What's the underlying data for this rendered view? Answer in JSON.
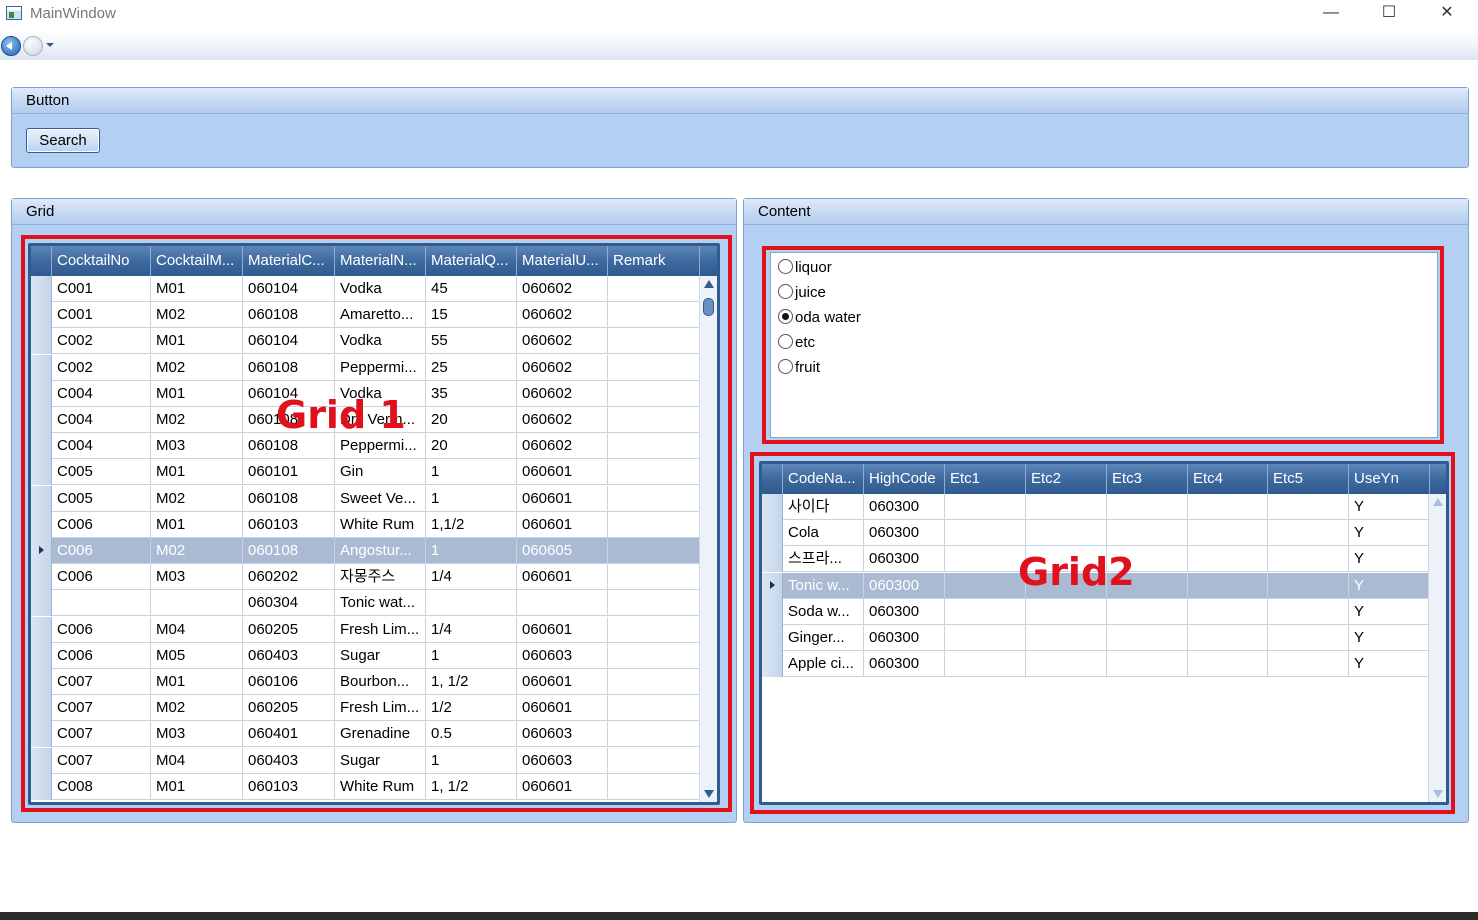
{
  "window": {
    "title": "MainWindow",
    "minimize": "—",
    "maximize": "☐",
    "close": "✕"
  },
  "button_group": {
    "header": "Button",
    "search_label": "Search"
  },
  "grid_group": {
    "header": "Grid"
  },
  "content_group": {
    "header": "Content"
  },
  "grid1": {
    "columns": [
      "CocktailNo",
      "CocktailM...",
      "MaterialC...",
      "MaterialN...",
      "MaterialQ...",
      "MaterialU...",
      "Remark"
    ],
    "rows": [
      [
        "C001",
        "M01",
        "060104",
        "Vodka",
        "45",
        "060602",
        ""
      ],
      [
        "C001",
        "M02",
        "060108",
        "Amaretto...",
        "15",
        "060602",
        ""
      ],
      [
        "C002",
        "M01",
        "060104",
        "Vodka",
        "55",
        "060602",
        ""
      ],
      [
        "C002",
        "M02",
        "060108",
        "Peppermi...",
        "25",
        "060602",
        ""
      ],
      [
        "C004",
        "M01",
        "060104",
        "Vodka",
        "35",
        "060602",
        ""
      ],
      [
        "C004",
        "M02",
        "060108",
        "Dry Verm...",
        "20",
        "060602",
        ""
      ],
      [
        "C004",
        "M03",
        "060108",
        "Peppermi...",
        "20",
        "060602",
        ""
      ],
      [
        "C005",
        "M01",
        "060101",
        "Gin",
        "1",
        "060601",
        ""
      ],
      [
        "C005",
        "M02",
        "060108",
        "Sweet Ve...",
        "1",
        "060601",
        ""
      ],
      [
        "C006",
        "M01",
        "060103",
        "White Rum",
        "1,1/2",
        "060601",
        ""
      ],
      [
        "C006",
        "M02",
        "060108",
        "Angostur...",
        "1",
        "060605",
        ""
      ],
      [
        "C006",
        "M03",
        "060202",
        "자몽주스",
        "1/4",
        "060601",
        ""
      ],
      [
        "",
        "",
        "060304",
        "Tonic wat...",
        "",
        "",
        ""
      ],
      [
        "C006",
        "M04",
        "060205",
        "Fresh Lim...",
        "1/4",
        "060601",
        ""
      ],
      [
        "C006",
        "M05",
        "060403",
        "Sugar",
        "1",
        "060603",
        ""
      ],
      [
        "C007",
        "M01",
        "060106",
        "Bourbon...",
        "1, 1/2",
        "060601",
        ""
      ],
      [
        "C007",
        "M02",
        "060205",
        "Fresh Lim...",
        "1/2",
        "060601",
        ""
      ],
      [
        "C007",
        "M03",
        "060401",
        "Grenadine",
        "0.5",
        "060603",
        ""
      ],
      [
        "C007",
        "M04",
        "060403",
        "Sugar",
        "1",
        "060603",
        ""
      ],
      [
        "C008",
        "M01",
        "060103",
        "White Rum",
        "1, 1/2",
        "060601",
        ""
      ]
    ],
    "selected_row": 10,
    "annotation": "Grid 1"
  },
  "radios": {
    "items": [
      "liquor",
      "juice",
      "oda water",
      "etc",
      "fruit"
    ],
    "selected": 2
  },
  "grid2": {
    "columns": [
      "CodeNa...",
      "HighCode",
      "Etc1",
      "Etc2",
      "Etc3",
      "Etc4",
      "Etc5",
      "UseYn"
    ],
    "rows": [
      [
        "사이다",
        "060300",
        "",
        "",
        "",
        "",
        "",
        "Y"
      ],
      [
        "Cola",
        "060300",
        "",
        "",
        "",
        "",
        "",
        "Y"
      ],
      [
        "스프라...",
        "060300",
        "",
        "",
        "",
        "",
        "",
        "Y"
      ],
      [
        "Tonic w...",
        "060300",
        "",
        "",
        "",
        "",
        "",
        "Y"
      ],
      [
        "Soda w...",
        "060300",
        "",
        "",
        "",
        "",
        "",
        "Y"
      ],
      [
        "Ginger...",
        "060300",
        "",
        "",
        "",
        "",
        "",
        "Y"
      ],
      [
        "Apple ci...",
        "060300",
        "",
        "",
        "",
        "",
        "",
        "Y"
      ]
    ],
    "selected_row": 3,
    "annotation": "Grid2"
  }
}
